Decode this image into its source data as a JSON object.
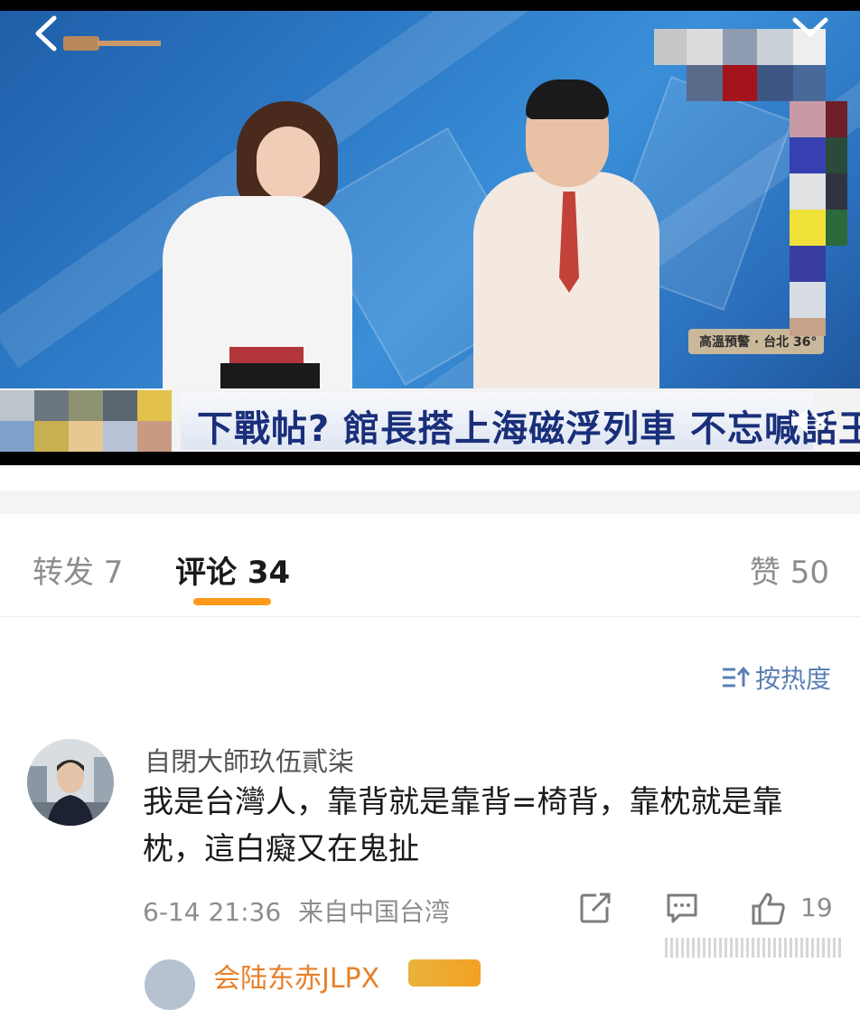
{
  "video": {
    "caption": "下戰帖? 館長搭上海磁浮列車  不忘喊話王義川",
    "weather_label": "高溫預警 · 台北 36°"
  },
  "tabs": {
    "repost": "转发 7",
    "comments": "评论 34",
    "likes": "赞 50"
  },
  "sort": {
    "label": "按热度"
  },
  "comment": {
    "username": "自閉大師玖伍貳柒",
    "text": "我是台灣人，靠背就是靠背=椅背，靠枕就是靠枕，這白癡又在鬼扯",
    "time": "6-14 21:36",
    "source": "来自中国台湾",
    "likes": "19"
  },
  "next_comment": {
    "username": "会陆东赤JLPX"
  },
  "colors": {
    "accent": "#ff9a1a",
    "link": "#5b7fb4",
    "caption_text": "#1a2f7a"
  },
  "icons": [
    "back-icon",
    "collapse-icon",
    "mute-icon",
    "sort-icon",
    "share-icon",
    "reply-icon",
    "like-icon"
  ]
}
